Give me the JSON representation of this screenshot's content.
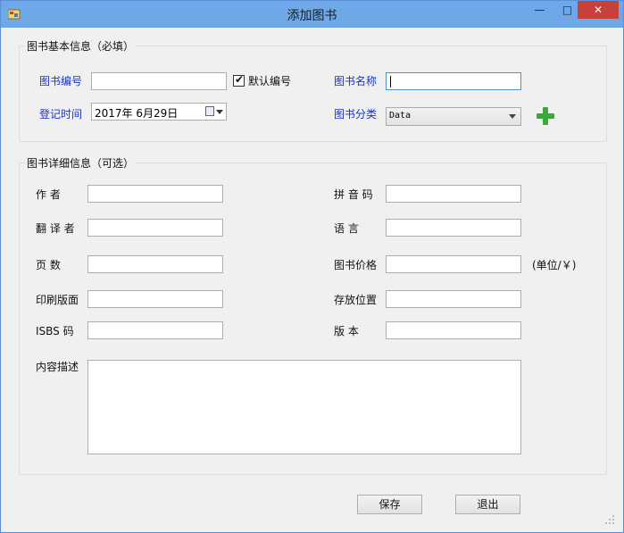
{
  "window": {
    "title": "添加图书",
    "min": "—",
    "max": "□",
    "close": "✕"
  },
  "basic": {
    "legend": "图书基本信息（必填）",
    "book_no_label": "图书编号",
    "book_no_value": "",
    "default_no_label": "默认编号",
    "default_no_checked": true,
    "book_name_label": "图书名称",
    "book_name_value": "",
    "reg_time_label": "登记时间",
    "reg_time_value": "2017年  6月29日",
    "category_label": "图书分类",
    "category_value": "Data"
  },
  "detail": {
    "legend": "图书详细信息（可选）",
    "author_label": "作    者",
    "pinyin_label": "拼 音 码",
    "translator_label": "翻 译 者",
    "language_label": "语    言",
    "pages_label": "页    数",
    "price_label": "图书价格",
    "price_unit": "(单位/￥)",
    "print_label": "印刷版面",
    "location_label": "存放位置",
    "isbn_label": "ISBS  码",
    "edition_label": "版    本",
    "desc_label": "内容描述"
  },
  "buttons": {
    "save": "保存",
    "exit": "退出"
  }
}
